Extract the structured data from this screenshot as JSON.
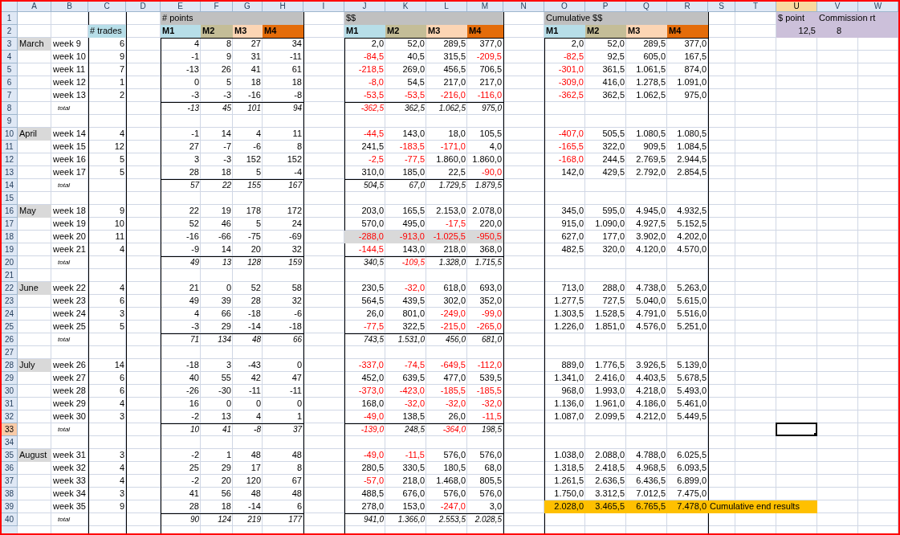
{
  "column_headers": [
    {
      "label": "A",
      "selected": false
    },
    {
      "label": "B",
      "selected": false
    },
    {
      "label": "C",
      "selected": false
    },
    {
      "label": "D",
      "selected": false
    },
    {
      "label": "E",
      "selected": false
    },
    {
      "label": "F",
      "selected": false
    },
    {
      "label": "G",
      "selected": false
    },
    {
      "label": "H",
      "selected": false
    },
    {
      "label": "I",
      "selected": false
    },
    {
      "label": "J",
      "selected": false
    },
    {
      "label": "K",
      "selected": false
    },
    {
      "label": "L",
      "selected": false
    },
    {
      "label": "M",
      "selected": false
    },
    {
      "label": "N",
      "selected": false
    },
    {
      "label": "O",
      "selected": false
    },
    {
      "label": "P",
      "selected": false
    },
    {
      "label": "Q",
      "selected": false
    },
    {
      "label": "R",
      "selected": false
    },
    {
      "label": "S",
      "selected": false
    },
    {
      "label": "T",
      "selected": false
    },
    {
      "label": "U",
      "selected": true
    },
    {
      "label": "V",
      "selected": false
    },
    {
      "label": "W",
      "selected": false
    }
  ],
  "row_numbers": [
    {
      "label": "1",
      "selected": false
    },
    {
      "label": "2",
      "selected": false
    },
    {
      "label": "3",
      "selected": false
    },
    {
      "label": "4",
      "selected": false
    },
    {
      "label": "5",
      "selected": false
    },
    {
      "label": "6",
      "selected": false
    },
    {
      "label": "7",
      "selected": false
    },
    {
      "label": "8",
      "selected": false
    },
    {
      "label": "9",
      "selected": false
    },
    {
      "label": "10",
      "selected": false
    },
    {
      "label": "11",
      "selected": false
    },
    {
      "label": "12",
      "selected": false
    },
    {
      "label": "13",
      "selected": false
    },
    {
      "label": "14",
      "selected": false
    },
    {
      "label": "15",
      "selected": false
    },
    {
      "label": "16",
      "selected": false
    },
    {
      "label": "17",
      "selected": false
    },
    {
      "label": "18",
      "selected": false
    },
    {
      "label": "19",
      "selected": false
    },
    {
      "label": "20",
      "selected": false
    },
    {
      "label": "21",
      "selected": false
    },
    {
      "label": "22",
      "selected": false
    },
    {
      "label": "23",
      "selected": false
    },
    {
      "label": "24",
      "selected": false
    },
    {
      "label": "25",
      "selected": false
    },
    {
      "label": "26",
      "selected": false
    },
    {
      "label": "27",
      "selected": false
    },
    {
      "label": "28",
      "selected": false
    },
    {
      "label": "29",
      "selected": false
    },
    {
      "label": "30",
      "selected": false
    },
    {
      "label": "31",
      "selected": false
    },
    {
      "label": "32",
      "selected": false
    },
    {
      "label": "33",
      "selected": true
    },
    {
      "label": "34",
      "selected": false
    },
    {
      "label": "35",
      "selected": false
    },
    {
      "label": "36",
      "selected": false
    },
    {
      "label": "37",
      "selected": false
    },
    {
      "label": "38",
      "selected": false
    },
    {
      "label": "39",
      "selected": false
    },
    {
      "label": "40",
      "selected": false
    }
  ],
  "trades_header": "# trades",
  "sections": {
    "points": {
      "title": "# points",
      "models": [
        {
          "label": "M1",
          "color": "#b7dee8"
        },
        {
          "label": "M2",
          "color": "#c4bd97"
        },
        {
          "label": "M3",
          "color": "#fcd5b4"
        },
        {
          "label": "M4",
          "color": "#e46c0a"
        }
      ]
    },
    "dollars": {
      "title": "$$",
      "models": [
        {
          "label": "M1",
          "color": "#b7dee8"
        },
        {
          "label": "M2",
          "color": "#c4bd97"
        },
        {
          "label": "M3",
          "color": "#fcd5b4"
        },
        {
          "label": "M4",
          "color": "#e46c0a"
        }
      ]
    },
    "cumulative": {
      "title": "Cumulative $$",
      "models": [
        {
          "label": "M1",
          "color": "#b7dee8"
        },
        {
          "label": "M2",
          "color": "#c4bd97"
        },
        {
          "label": "M3",
          "color": "#fcd5b4"
        },
        {
          "label": "M4",
          "color": "#e46c0a"
        }
      ]
    }
  },
  "settings": [
    {
      "label": "$ point",
      "value": "12,5"
    },
    {
      "label": "Commission rt",
      "value": "8"
    }
  ],
  "months": [
    {
      "name": "March",
      "weeks": [
        {
          "label": "week 9",
          "trades": "6",
          "points": [
            "4",
            "8",
            "27",
            "34"
          ],
          "dollars": [
            "2,0",
            "52,0",
            "289,5",
            "377,0"
          ],
          "cumulative": [
            "2,0",
            "52,0",
            "289,5",
            "377,0"
          ],
          "dollars_highlighted": false,
          "cumulative_highlighted": false
        },
        {
          "label": "week 10",
          "trades": "9",
          "points": [
            "-1",
            "9",
            "31",
            "-11"
          ],
          "dollars": [
            "-84,5",
            "40,5",
            "315,5",
            "-209,5"
          ],
          "cumulative": [
            "-82,5",
            "92,5",
            "605,0",
            "167,5"
          ],
          "dollars_highlighted": false,
          "cumulative_highlighted": false
        },
        {
          "label": "week 11",
          "trades": "7",
          "points": [
            "-13",
            "26",
            "41",
            "61"
          ],
          "dollars": [
            "-218,5",
            "269,0",
            "456,5",
            "706,5"
          ],
          "cumulative": [
            "-301,0",
            "361,5",
            "1.061,5",
            "874,0"
          ],
          "dollars_highlighted": false,
          "cumulative_highlighted": false
        },
        {
          "label": "week 12",
          "trades": "1",
          "points": [
            "0",
            "5",
            "18",
            "18"
          ],
          "dollars": [
            "-8,0",
            "54,5",
            "217,0",
            "217,0"
          ],
          "cumulative": [
            "-309,0",
            "416,0",
            "1.278,5",
            "1.091,0"
          ],
          "dollars_highlighted": false,
          "cumulative_highlighted": false
        },
        {
          "label": "week 13",
          "trades": "2",
          "points": [
            "-3",
            "-3",
            "-16",
            "-8"
          ],
          "dollars": [
            "-53,5",
            "-53,5",
            "-216,0",
            "-116,0"
          ],
          "cumulative": [
            "-362,5",
            "362,5",
            "1.062,5",
            "975,0"
          ],
          "dollars_highlighted": false,
          "cumulative_highlighted": false
        }
      ],
      "total": {
        "label": "total",
        "points": [
          "-13",
          "45",
          "101",
          "94"
        ],
        "dollars": [
          "-362,5",
          "362,5",
          "1.062,5",
          "975,0"
        ]
      }
    },
    {
      "name": "April",
      "weeks": [
        {
          "label": "week 14",
          "trades": "4",
          "points": [
            "-1",
            "14",
            "4",
            "11"
          ],
          "dollars": [
            "-44,5",
            "143,0",
            "18,0",
            "105,5"
          ],
          "cumulative": [
            "-407,0",
            "505,5",
            "1.080,5",
            "1.080,5"
          ],
          "dollars_highlighted": false,
          "cumulative_highlighted": false
        },
        {
          "label": "week 15",
          "trades": "12",
          "points": [
            "27",
            "-7",
            "-6",
            "8"
          ],
          "dollars": [
            "241,5",
            "-183,5",
            "-171,0",
            "4,0"
          ],
          "cumulative": [
            "-165,5",
            "322,0",
            "909,5",
            "1.084,5"
          ],
          "dollars_highlighted": false,
          "cumulative_highlighted": false
        },
        {
          "label": "week 16",
          "trades": "5",
          "points": [
            "3",
            "-3",
            "152",
            "152"
          ],
          "dollars": [
            "-2,5",
            "-77,5",
            "1.860,0",
            "1.860,0"
          ],
          "cumulative": [
            "-168,0",
            "244,5",
            "2.769,5",
            "2.944,5"
          ],
          "dollars_highlighted": false,
          "cumulative_highlighted": false
        },
        {
          "label": "week 17",
          "trades": "5",
          "points": [
            "28",
            "18",
            "5",
            "-4"
          ],
          "dollars": [
            "310,0",
            "185,0",
            "22,5",
            "-90,0"
          ],
          "cumulative": [
            "142,0",
            "429,5",
            "2.792,0",
            "2.854,5"
          ],
          "dollars_highlighted": false,
          "cumulative_highlighted": false
        }
      ],
      "total": {
        "label": "total",
        "points": [
          "57",
          "22",
          "155",
          "167"
        ],
        "dollars": [
          "504,5",
          "67,0",
          "1.729,5",
          "1.879,5"
        ]
      }
    },
    {
      "name": "May",
      "weeks": [
        {
          "label": "week 18",
          "trades": "9",
          "points": [
            "22",
            "19",
            "178",
            "172"
          ],
          "dollars": [
            "203,0",
            "165,5",
            "2.153,0",
            "2.078,0"
          ],
          "cumulative": [
            "345,0",
            "595,0",
            "4.945,0",
            "4.932,5"
          ],
          "dollars_highlighted": false,
          "cumulative_highlighted": false
        },
        {
          "label": "week 19",
          "trades": "10",
          "points": [
            "52",
            "46",
            "5",
            "24"
          ],
          "dollars": [
            "570,0",
            "495,0",
            "-17,5",
            "220,0"
          ],
          "cumulative": [
            "915,0",
            "1.090,0",
            "4.927,5",
            "5.152,5"
          ],
          "dollars_highlighted": false,
          "cumulative_highlighted": false
        },
        {
          "label": "week 20",
          "trades": "11",
          "points": [
            "-16",
            "-66",
            "-75",
            "-69"
          ],
          "dollars": [
            "-288,0",
            "-913,0",
            "-1.025,5",
            "-950,5"
          ],
          "cumulative": [
            "627,0",
            "177,0",
            "3.902,0",
            "4.202,0"
          ],
          "dollars_highlighted": true,
          "cumulative_highlighted": false
        },
        {
          "label": "week 21",
          "trades": "4",
          "points": [
            "-9",
            "14",
            "20",
            "32"
          ],
          "dollars": [
            "-144,5",
            "143,0",
            "218,0",
            "368,0"
          ],
          "cumulative": [
            "482,5",
            "320,0",
            "4.120,0",
            "4.570,0"
          ],
          "dollars_highlighted": false,
          "cumulative_highlighted": false
        }
      ],
      "total": {
        "label": "total",
        "points": [
          "49",
          "13",
          "128",
          "159"
        ],
        "dollars": [
          "340,5",
          "-109,5",
          "1.328,0",
          "1.715,5"
        ]
      }
    },
    {
      "name": "June",
      "weeks": [
        {
          "label": "week 22",
          "trades": "4",
          "points": [
            "21",
            "0",
            "52",
            "58"
          ],
          "dollars": [
            "230,5",
            "-32,0",
            "618,0",
            "693,0"
          ],
          "cumulative": [
            "713,0",
            "288,0",
            "4.738,0",
            "5.263,0"
          ],
          "dollars_highlighted": false,
          "cumulative_highlighted": false
        },
        {
          "label": "week 23",
          "trades": "6",
          "points": [
            "49",
            "39",
            "28",
            "32"
          ],
          "dollars": [
            "564,5",
            "439,5",
            "302,0",
            "352,0"
          ],
          "cumulative": [
            "1.277,5",
            "727,5",
            "5.040,0",
            "5.615,0"
          ],
          "dollars_highlighted": false,
          "cumulative_highlighted": false
        },
        {
          "label": "week 24",
          "trades": "3",
          "points": [
            "4",
            "66",
            "-18",
            "-6"
          ],
          "dollars": [
            "26,0",
            "801,0",
            "-249,0",
            "-99,0"
          ],
          "cumulative": [
            "1.303,5",
            "1.528,5",
            "4.791,0",
            "5.516,0"
          ],
          "dollars_highlighted": false,
          "cumulative_highlighted": false
        },
        {
          "label": "week 25",
          "trades": "5",
          "points": [
            "-3",
            "29",
            "-14",
            "-18"
          ],
          "dollars": [
            "-77,5",
            "322,5",
            "-215,0",
            "-265,0"
          ],
          "cumulative": [
            "1.226,0",
            "1.851,0",
            "4.576,0",
            "5.251,0"
          ],
          "dollars_highlighted": false,
          "cumulative_highlighted": false
        }
      ],
      "total": {
        "label": "total",
        "points": [
          "71",
          "134",
          "48",
          "66"
        ],
        "dollars": [
          "743,5",
          "1.531,0",
          "456,0",
          "681,0"
        ]
      }
    },
    {
      "name": "July",
      "weeks": [
        {
          "label": "week 26",
          "trades": "14",
          "points": [
            "-18",
            "3",
            "-43",
            "0"
          ],
          "dollars": [
            "-337,0",
            "-74,5",
            "-649,5",
            "-112,0"
          ],
          "cumulative": [
            "889,0",
            "1.776,5",
            "3.926,5",
            "5.139,0"
          ],
          "dollars_highlighted": false,
          "cumulative_highlighted": false
        },
        {
          "label": "week 27",
          "trades": "6",
          "points": [
            "40",
            "55",
            "42",
            "47"
          ],
          "dollars": [
            "452,0",
            "639,5",
            "477,0",
            "539,5"
          ],
          "cumulative": [
            "1.341,0",
            "2.416,0",
            "4.403,5",
            "5.678,5"
          ],
          "dollars_highlighted": false,
          "cumulative_highlighted": false
        },
        {
          "label": "week 28",
          "trades": "6",
          "points": [
            "-26",
            "-30",
            "-11",
            "-11"
          ],
          "dollars": [
            "-373,0",
            "-423,0",
            "-185,5",
            "-185,5"
          ],
          "cumulative": [
            "968,0",
            "1.993,0",
            "4.218,0",
            "5.493,0"
          ],
          "dollars_highlighted": false,
          "cumulative_highlighted": false
        },
        {
          "label": "week 29",
          "trades": "4",
          "points": [
            "16",
            "0",
            "0",
            "0"
          ],
          "dollars": [
            "168,0",
            "-32,0",
            "-32,0",
            "-32,0"
          ],
          "cumulative": [
            "1.136,0",
            "1.961,0",
            "4.186,0",
            "5.461,0"
          ],
          "dollars_highlighted": false,
          "cumulative_highlighted": false
        },
        {
          "label": "week 30",
          "trades": "3",
          "points": [
            "-2",
            "13",
            "4",
            "1"
          ],
          "dollars": [
            "-49,0",
            "138,5",
            "26,0",
            "-11,5"
          ],
          "cumulative": [
            "1.087,0",
            "2.099,5",
            "4.212,0",
            "5.449,5"
          ],
          "dollars_highlighted": false,
          "cumulative_highlighted": false
        }
      ],
      "total": {
        "label": "total",
        "points": [
          "10",
          "41",
          "-8",
          "37"
        ],
        "dollars": [
          "-139,0",
          "248,5",
          "-364,0",
          "198,5"
        ]
      }
    },
    {
      "name": "August",
      "weeks": [
        {
          "label": "week 31",
          "trades": "3",
          "points": [
            "-2",
            "1",
            "48",
            "48"
          ],
          "dollars": [
            "-49,0",
            "-11,5",
            "576,0",
            "576,0"
          ],
          "cumulative": [
            "1.038,0",
            "2.088,0",
            "4.788,0",
            "6.025,5"
          ],
          "dollars_highlighted": false,
          "cumulative_highlighted": false
        },
        {
          "label": "week 32",
          "trades": "4",
          "points": [
            "25",
            "29",
            "17",
            "8"
          ],
          "dollars": [
            "280,5",
            "330,5",
            "180,5",
            "68,0"
          ],
          "cumulative": [
            "1.318,5",
            "2.418,5",
            "4.968,5",
            "6.093,5"
          ],
          "dollars_highlighted": false,
          "cumulative_highlighted": false
        },
        {
          "label": "week 33",
          "trades": "4",
          "points": [
            "-2",
            "20",
            "120",
            "67"
          ],
          "dollars": [
            "-57,0",
            "218,0",
            "1.468,0",
            "805,5"
          ],
          "cumulative": [
            "1.261,5",
            "2.636,5",
            "6.436,5",
            "6.899,0"
          ],
          "dollars_highlighted": false,
          "cumulative_highlighted": false
        },
        {
          "label": "week 34",
          "trades": "3",
          "points": [
            "41",
            "56",
            "48",
            "48"
          ],
          "dollars": [
            "488,5",
            "676,0",
            "576,0",
            "576,0"
          ],
          "cumulative": [
            "1.750,0",
            "3.312,5",
            "7.012,5",
            "7.475,0"
          ],
          "dollars_highlighted": false,
          "cumulative_highlighted": false
        },
        {
          "label": "week 35",
          "trades": "9",
          "points": [
            "28",
            "18",
            "-14",
            "6"
          ],
          "dollars": [
            "278,0",
            "153,0",
            "-247,0",
            "3,0"
          ],
          "cumulative": [
            "2.028,0",
            "3.465,5",
            "6.765,5",
            "7.478,0"
          ],
          "dollars_highlighted": false,
          "cumulative_highlighted": true,
          "note": "Cumulative end results"
        }
      ],
      "total": {
        "label": "total",
        "points": [
          "90",
          "124",
          "219",
          "177"
        ],
        "dollars": [
          "941,0",
          "1.366,0",
          "2.553,5",
          "2.028,5"
        ]
      }
    }
  ]
}
